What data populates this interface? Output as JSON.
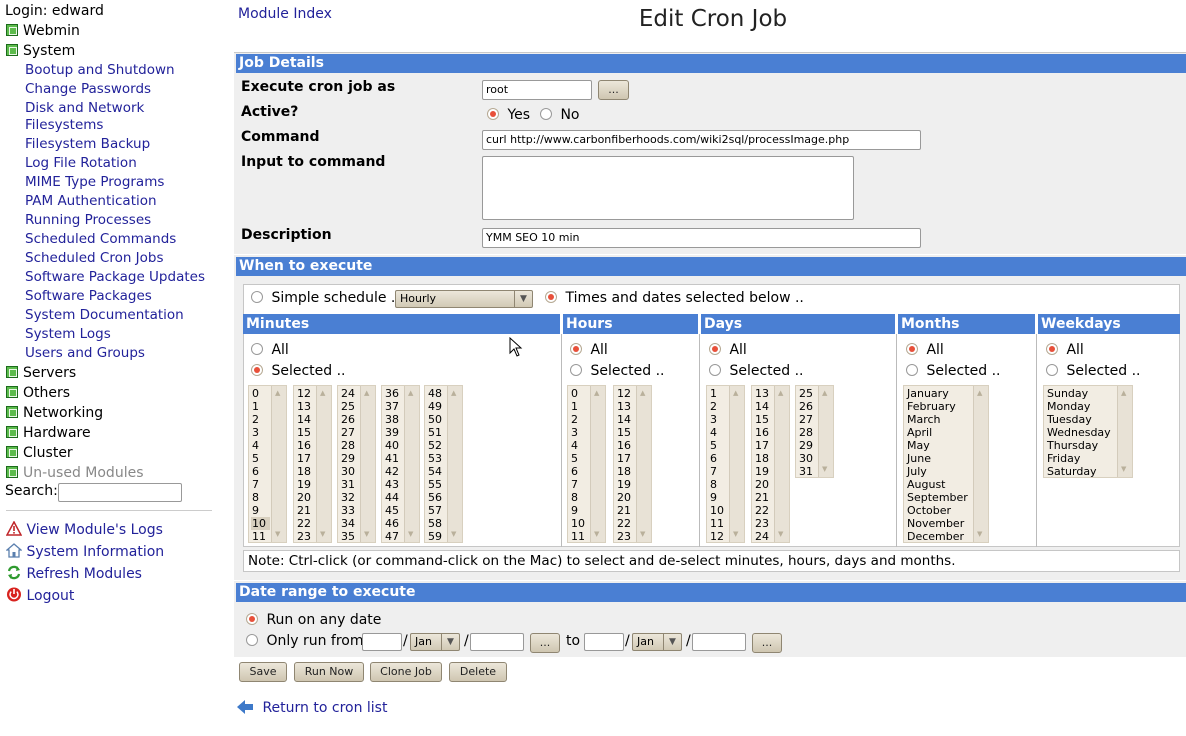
{
  "sidebar": {
    "login": "Login: edward",
    "categories": {
      "webmin": "Webmin",
      "system": "System",
      "servers": "Servers",
      "others": "Others",
      "networking": "Networking",
      "hardware": "Hardware",
      "cluster": "Cluster",
      "unused": "Un-used Modules"
    },
    "system_items": [
      "Bootup and Shutdown",
      "Change Passwords",
      "Disk and Network",
      "Filesystems",
      "Filesystem Backup",
      "Log File Rotation",
      "MIME Type Programs",
      "PAM Authentication",
      "Running Processes",
      "Scheduled Commands",
      "Scheduled Cron Jobs",
      "Software Package Updates",
      "Software Packages",
      "System Documentation",
      "System Logs",
      "Users and Groups"
    ],
    "search_label": "Search:",
    "search_value": "",
    "links": {
      "view_logs": "View Module's Logs",
      "system_info": "System Information",
      "refresh": "Refresh Modules",
      "logout": "Logout"
    }
  },
  "page": {
    "module_index": "Module Index",
    "title": "Edit Cron Job",
    "return_link": "Return to cron list"
  },
  "job_details": {
    "section": "Job Details",
    "execute_as_label": "Execute cron job as",
    "execute_as_value": "root",
    "browse_button": "...",
    "active_label": "Active?",
    "active_yes": "Yes",
    "active_no": "No",
    "command_label": "Command",
    "command_value": "curl http://www.carbonfiberhoods.com/wiki2sql/processImage.php",
    "input_label": "Input to command",
    "input_value": "",
    "description_label": "Description",
    "description_value": "YMM SEO 10 min"
  },
  "when": {
    "section": "When to execute",
    "simple_label": "Simple schedule ..",
    "simple_select": "Hourly",
    "times_label": "Times and dates selected below ..",
    "all": "All",
    "selected": "Selected ..",
    "headers": {
      "minutes": "Minutes",
      "hours": "Hours",
      "days": "Days",
      "months": "Months",
      "weekdays": "Weekdays"
    },
    "minutes_cols": [
      [
        "0",
        "1",
        "2",
        "3",
        "4",
        "5",
        "6",
        "7",
        "8",
        "9",
        "10",
        "11"
      ],
      [
        "12",
        "13",
        "14",
        "15",
        "16",
        "17",
        "18",
        "19",
        "20",
        "21",
        "22",
        "23"
      ],
      [
        "24",
        "25",
        "26",
        "27",
        "28",
        "29",
        "30",
        "31",
        "32",
        "33",
        "34",
        "35"
      ],
      [
        "36",
        "37",
        "38",
        "39",
        "40",
        "41",
        "42",
        "43",
        "44",
        "45",
        "46",
        "47"
      ],
      [
        "48",
        "49",
        "50",
        "51",
        "52",
        "53",
        "54",
        "55",
        "56",
        "57",
        "58",
        "59"
      ]
    ],
    "hours_cols": [
      [
        "0",
        "1",
        "2",
        "3",
        "4",
        "5",
        "6",
        "7",
        "8",
        "9",
        "10",
        "11"
      ],
      [
        "12",
        "13",
        "14",
        "15",
        "16",
        "17",
        "18",
        "19",
        "20",
        "21",
        "22",
        "23"
      ]
    ],
    "days_cols": [
      [
        "1",
        "2",
        "3",
        "4",
        "5",
        "6",
        "7",
        "8",
        "9",
        "10",
        "11",
        "12"
      ],
      [
        "13",
        "14",
        "15",
        "16",
        "17",
        "18",
        "19",
        "20",
        "21",
        "22",
        "23",
        "24"
      ],
      [
        "25",
        "26",
        "27",
        "28",
        "29",
        "30",
        "31"
      ]
    ],
    "months": [
      "January",
      "February",
      "March",
      "April",
      "May",
      "June",
      "July",
      "August",
      "September",
      "October",
      "November",
      "December"
    ],
    "weekdays": [
      "Sunday",
      "Monday",
      "Tuesday",
      "Wednesday",
      "Thursday",
      "Friday",
      "Saturday"
    ],
    "note": "Note: Ctrl-click (or command-click on the Mac) to select and de-select minutes, hours, days and months."
  },
  "date_range": {
    "section": "Date range to execute",
    "any_date": "Run on any date",
    "only_from": "Only run from",
    "month_from": "Jan",
    "to": "to",
    "month_to": "Jan",
    "browse": "...",
    "slash": "/"
  },
  "buttons": {
    "save": "Save",
    "run_now": "Run Now",
    "clone": "Clone Job",
    "delete": "Delete"
  },
  "colors": {
    "section_bar": "#4a7fd3",
    "link": "#22229a",
    "radio_on": "#e8503a",
    "category_icon": "#5cbb4c"
  }
}
